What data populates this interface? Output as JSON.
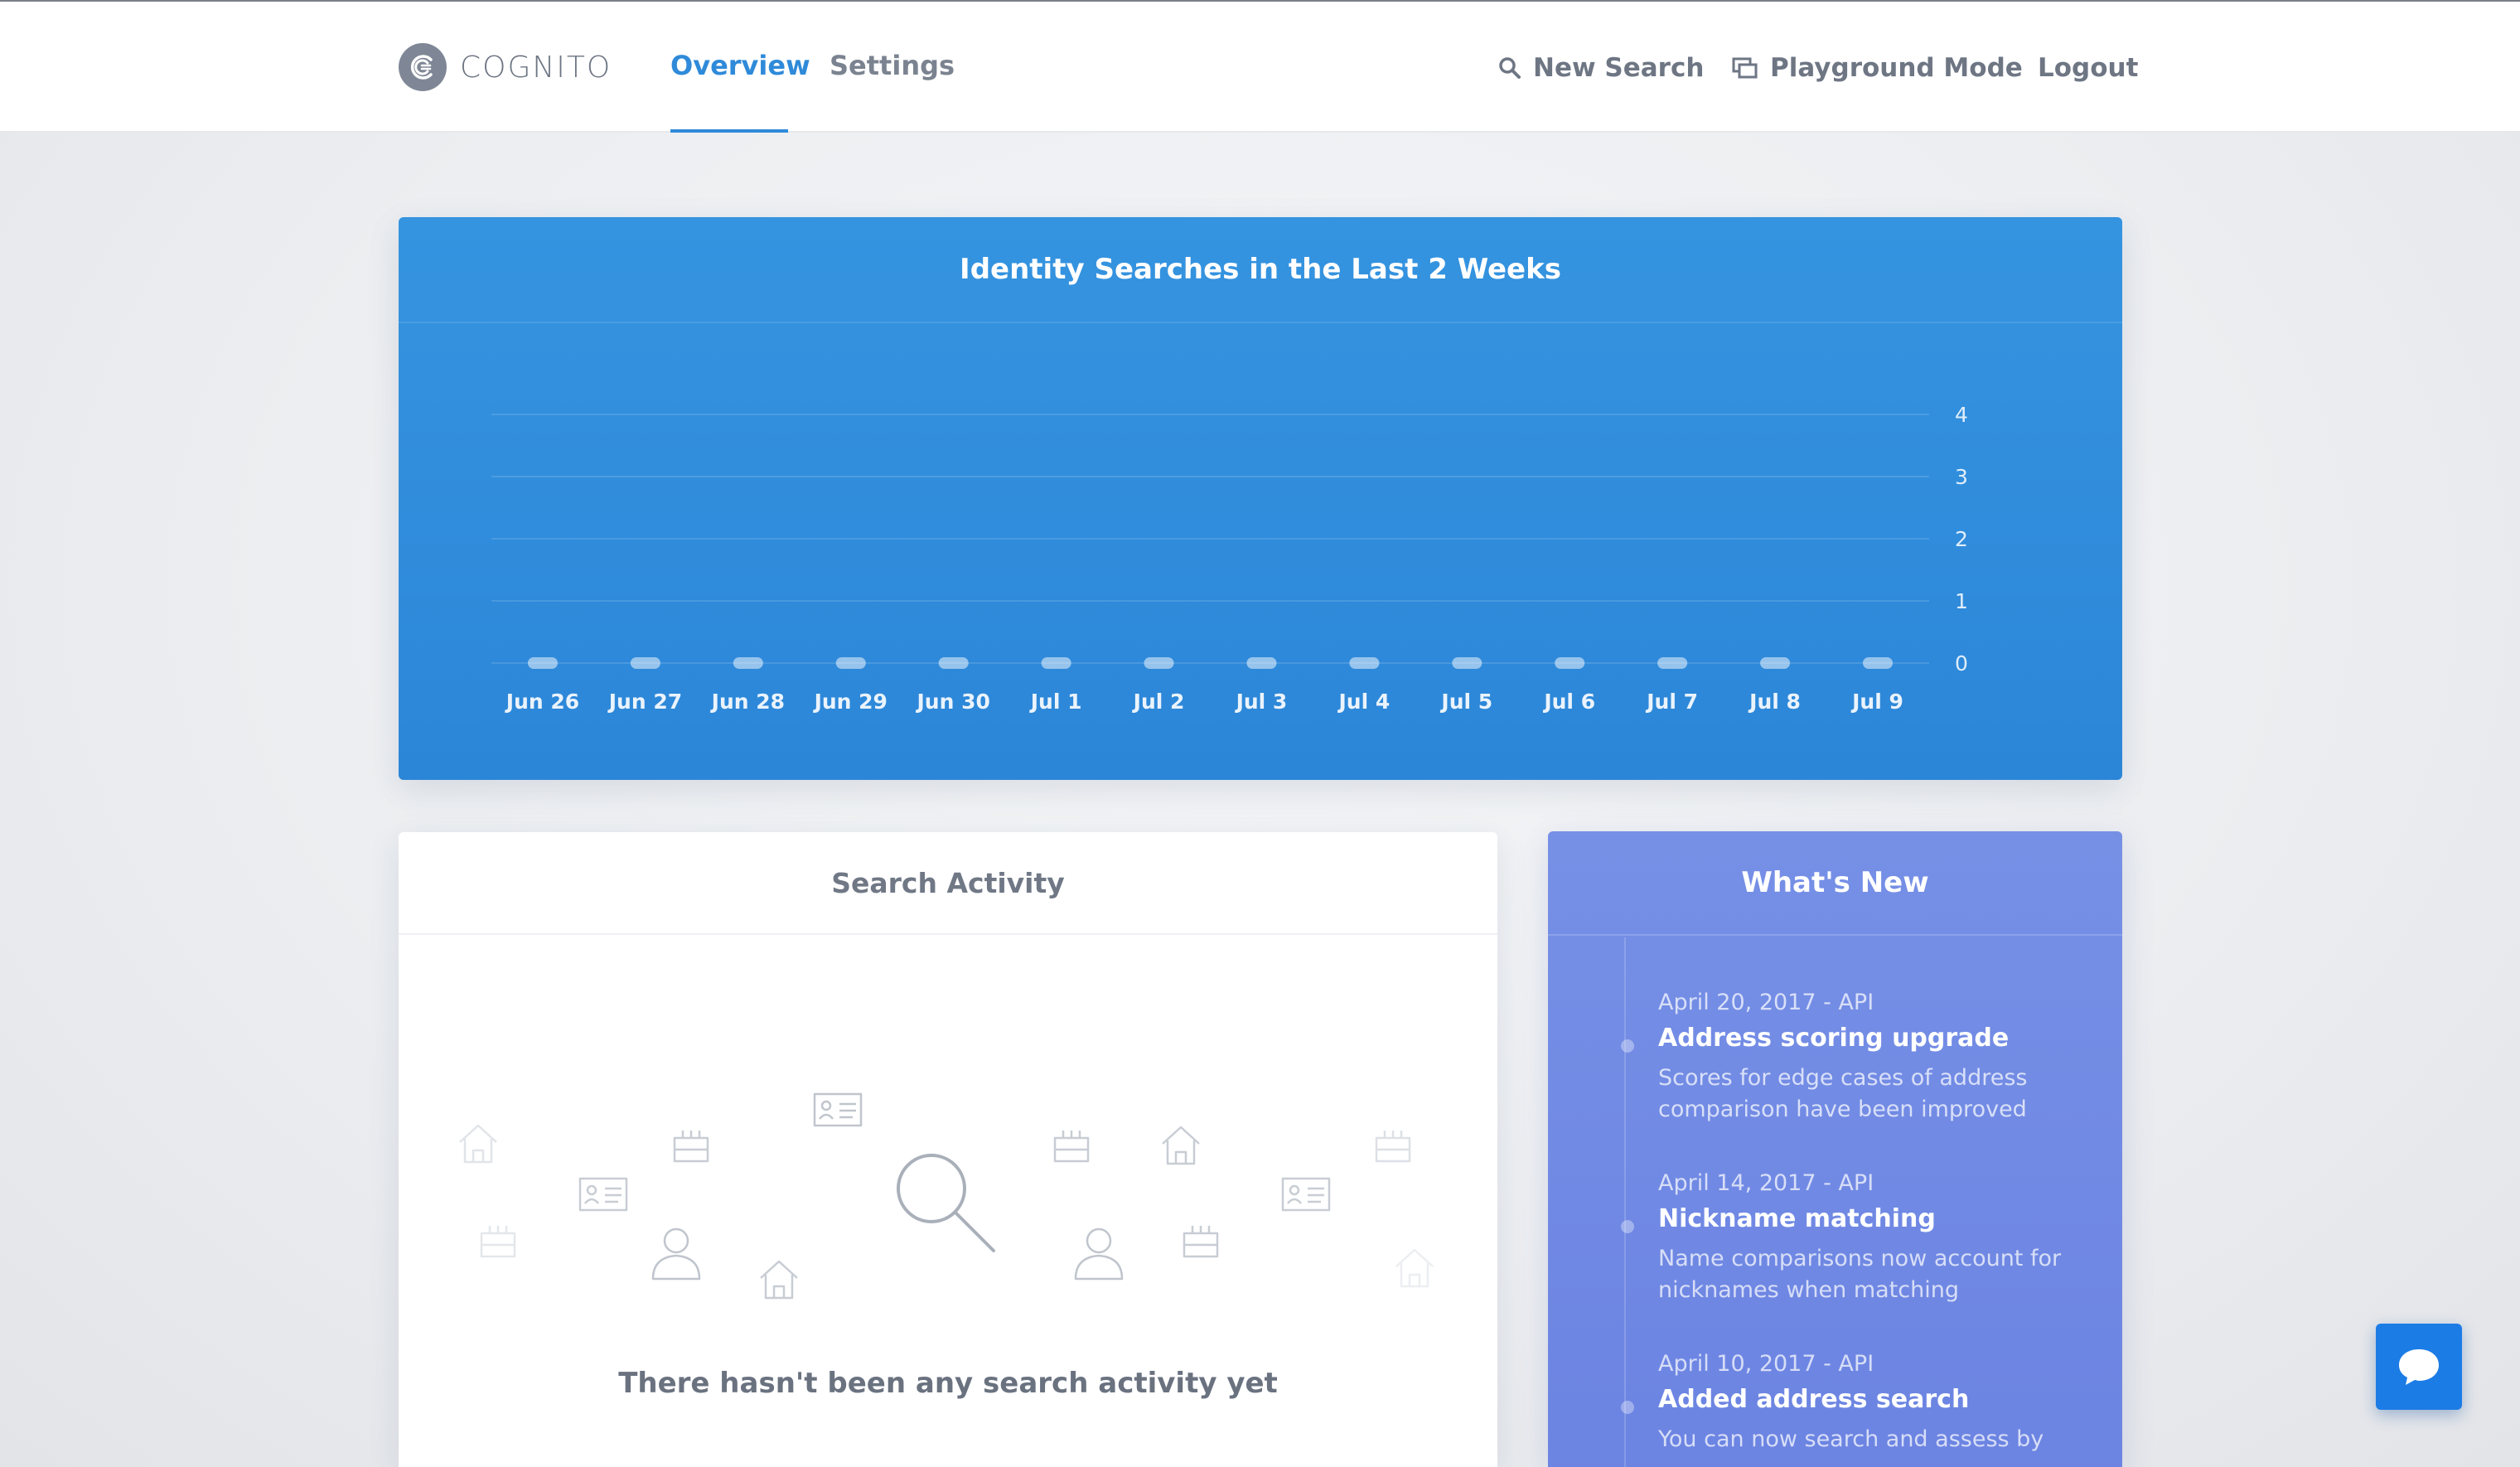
{
  "app": {
    "brand": "COGNITO",
    "accent_color": "#2f8ad9",
    "brand_icon": "cognito-logo-icon"
  },
  "nav": {
    "tabs": [
      {
        "label": "Overview",
        "active": true
      },
      {
        "label": "Settings",
        "active": false
      }
    ],
    "right": {
      "new_search": {
        "label": "New Search",
        "icon": "search-icon"
      },
      "playground": {
        "label": "Playground Mode",
        "icon": "windows-icon"
      },
      "logout": {
        "label": "Logout"
      }
    }
  },
  "chart_card": {
    "title": "Identity Searches in the Last 2 Weeks",
    "color": "#3594e0"
  },
  "chart_data": {
    "type": "bar",
    "title": "Identity Searches in the Last 2 Weeks",
    "categories": [
      "Jun 26",
      "Jun 27",
      "Jun 28",
      "Jun 29",
      "Jun 30",
      "Jul 1",
      "Jul 2",
      "Jul 3",
      "Jul 4",
      "Jul 5",
      "Jul 6",
      "Jul 7",
      "Jul 8",
      "Jul 9"
    ],
    "values": [
      0,
      0,
      0,
      0,
      0,
      0,
      0,
      0,
      0,
      0,
      0,
      0,
      0,
      0
    ],
    "ylim": [
      0,
      4
    ],
    "yticks": [
      "0",
      "1",
      "2",
      "3",
      "4"
    ],
    "y_axis_side": "right",
    "grid": true
  },
  "activity": {
    "title": "Search Activity",
    "empty_message": "There hasn't been any search activity yet",
    "illustration_icons": [
      "house-icon",
      "birthday-cake-icon",
      "id-card-icon",
      "person-icon",
      "magnifier-icon"
    ]
  },
  "whats_new": {
    "title": "What's New",
    "color": "#7690e6",
    "items": [
      {
        "date": "April 20, 2017 - API",
        "title": "Address scoring upgrade",
        "description": "Scores for edge cases of address comparison have been improved"
      },
      {
        "date": "April 14, 2017 - API",
        "title": "Nickname matching",
        "description": "Name comparisons now account for nicknames when matching"
      },
      {
        "date": "April 10, 2017 - API",
        "title": "Added address search",
        "description": "You can now search and assess by"
      }
    ]
  },
  "chat": {
    "icon": "chat-bubble-icon",
    "color": "#1c7ce6"
  }
}
